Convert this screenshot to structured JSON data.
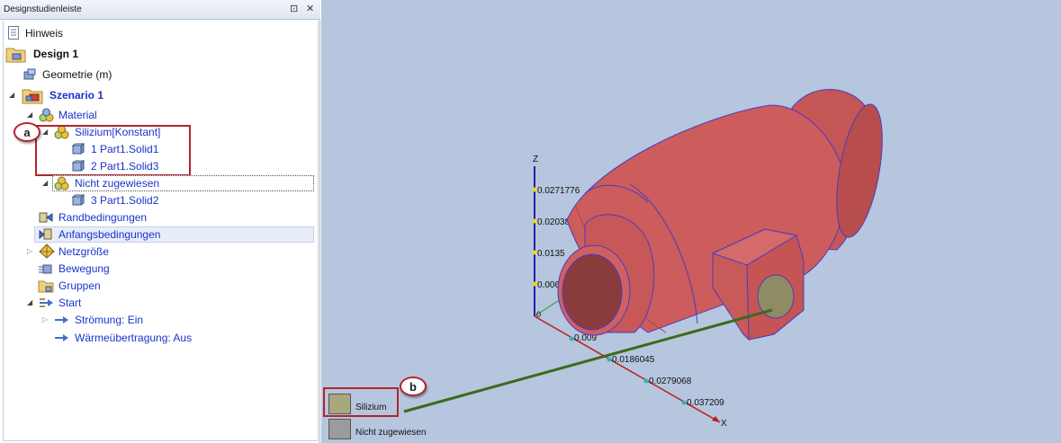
{
  "panel": {
    "title": "Designstudienleiste",
    "pin_glyph": "⊡",
    "close_glyph": "✕"
  },
  "tree": {
    "hinweis": "Hinweis",
    "design": "Design 1",
    "geometrie": "Geometrie (m)",
    "szenario": "Szenario 1",
    "material": "Material",
    "silizium": "Silizium[Konstant]",
    "solid1": "1 Part1.Solid1",
    "solid3": "2 Part1.Solid3",
    "nicht": "Nicht zugewiesen",
    "solid2": "3 Part1.Solid2",
    "randbedingungen": "Randbedingungen",
    "anfangsbedingungen": "Anfangsbedingungen",
    "netzgroesse": "Netzgröße",
    "bewegung": "Bewegung",
    "gruppen": "Gruppen",
    "start": "Start",
    "stroemung": "Strömung: Ein",
    "waerme": "Wärmeübertragung: Aus"
  },
  "axes": {
    "z_label": "Z",
    "x_label": "X",
    "z_ticks": [
      "0.0271776",
      "0.0203832",
      "0.0135",
      "0.0067",
      "0"
    ],
    "x_ticks": [
      "0.009",
      "0.0186045",
      "0.0279068",
      "0.037209"
    ]
  },
  "legend": {
    "items": [
      {
        "label": "Silizium",
        "color": "#a9a77d"
      },
      {
        "label": "Nicht zugewiesen",
        "color": "#9b9b9b"
      }
    ]
  },
  "callouts": {
    "a": "a",
    "b": "b"
  },
  "colors": {
    "viewport_bg": "#b5c6de",
    "part_red": "#cd5c5c",
    "part_edge": "#4a3bbf",
    "callout_red": "#b3232e",
    "leader_green": "#3c6a1e"
  }
}
